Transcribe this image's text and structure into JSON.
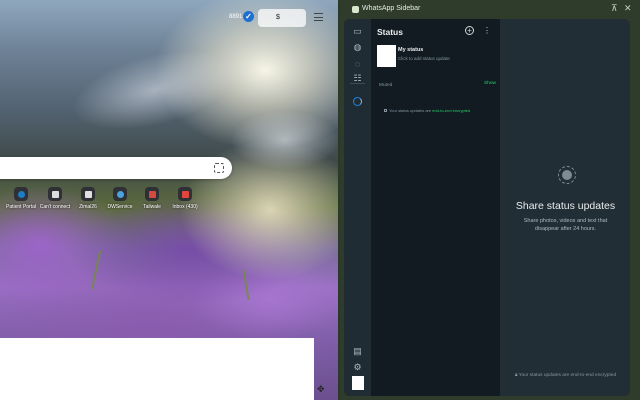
{
  "browser": {
    "toolbar": {
      "badge_text": "8891",
      "ext_icon": "shield-icon",
      "price_symbol": "$",
      "menu_icon": "hamburger-icon"
    },
    "search": {
      "lens_icon": "google-lens-icon"
    },
    "shortcuts": [
      {
        "label": "Patient Portal",
        "icon": "portal-icon",
        "color": "#1e7cc4"
      },
      {
        "label": "Can't connect",
        "icon": "page-icon",
        "color": "#dddddd"
      },
      {
        "label": "Zimal26",
        "icon": "grid-icon",
        "color": "#e0e0e0"
      },
      {
        "label": "DWService",
        "icon": "cloud-icon",
        "color": "#4aa3df"
      },
      {
        "label": "Tailwale",
        "icon": "tail-icon",
        "color": "#d24b3e"
      },
      {
        "label": "Inbox (430)",
        "icon": "mail-icon",
        "color": "#e0463c"
      }
    ],
    "corner_icon": "extensions-icon"
  },
  "sidebar": {
    "title": "WhatsApp Sidebar",
    "pin_icon": "pin-icon",
    "close_icon": "close-icon"
  },
  "whatsapp": {
    "rail_icons": [
      "chats-icon",
      "status-icon",
      "channels-icon",
      "communities-icon",
      "status-ring-icon",
      "archive-icon",
      "settings-icon"
    ],
    "status_panel": {
      "title": "Status",
      "my_status": {
        "name": "My status",
        "subtitle": "Click to add status update"
      },
      "muted_label": "Muted",
      "show_label": "Show",
      "e2e_prefix": "Your status updates are ",
      "e2e_accent": "end-to-end encrypted"
    },
    "main": {
      "heading": "Share status updates",
      "subtext": "Share photos, videos and text that disappear after 24 hours.",
      "e2e_footer": "Your status updates are end-to-end encrypted"
    },
    "colors": {
      "accent": "#25d366",
      "status_ring": "#1e88e5",
      "panel_bg": "#111b21"
    }
  }
}
